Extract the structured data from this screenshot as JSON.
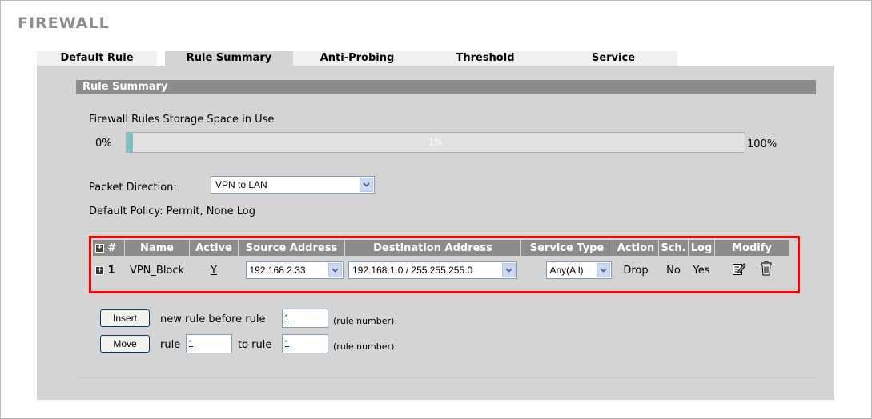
{
  "page": {
    "title": "FIREWALL"
  },
  "tabs": [
    {
      "label": "Default Rule",
      "active": false
    },
    {
      "label": "Rule Summary",
      "active": true
    },
    {
      "label": "Anti-Probing",
      "active": false
    },
    {
      "label": "Threshold",
      "active": false
    },
    {
      "label": "Service",
      "active": false
    }
  ],
  "section": {
    "title": "Rule Summary"
  },
  "storage": {
    "label": "Firewall Rules Storage Space in Use",
    "min_label": "0%",
    "max_label": "100%",
    "percent_text": "1%",
    "percent": 1
  },
  "packet_direction": {
    "label": "Packet Direction:",
    "value": "VPN to LAN"
  },
  "default_policy": {
    "text": "Default Policy: Permit, None Log"
  },
  "table": {
    "headers": [
      "#",
      "Name",
      "Active",
      "Source Address",
      "Destination Address",
      "Service Type",
      "Action",
      "Sch.",
      "Log",
      "Modify"
    ],
    "rows": [
      {
        "number": "1",
        "name": "VPN_Block",
        "active": "Y",
        "source": "192.168.2.33",
        "destination": "192.168.1.0 / 255.255.255.0",
        "service": "Any(All)",
        "action": "Drop",
        "schedule": "No",
        "log": "Yes"
      }
    ]
  },
  "insert": {
    "button": "Insert",
    "text": "new rule before rule",
    "value": "1",
    "hint": "(rule number)"
  },
  "move": {
    "button": "Move",
    "text_rule": "rule",
    "value_from": "1",
    "text_to": "to rule",
    "value_to": "1",
    "hint": "(rule number)"
  },
  "colors": {
    "highlight": "#ff0000",
    "header_bg": "#8c8c8c",
    "panel_bg": "#d4d4d4",
    "storage_fill": "#7fc1c1"
  },
  "icons": {
    "expand": "plus-box-icon",
    "edit": "edit-icon",
    "delete": "trash-icon",
    "dropdown": "chevron-down-icon"
  }
}
